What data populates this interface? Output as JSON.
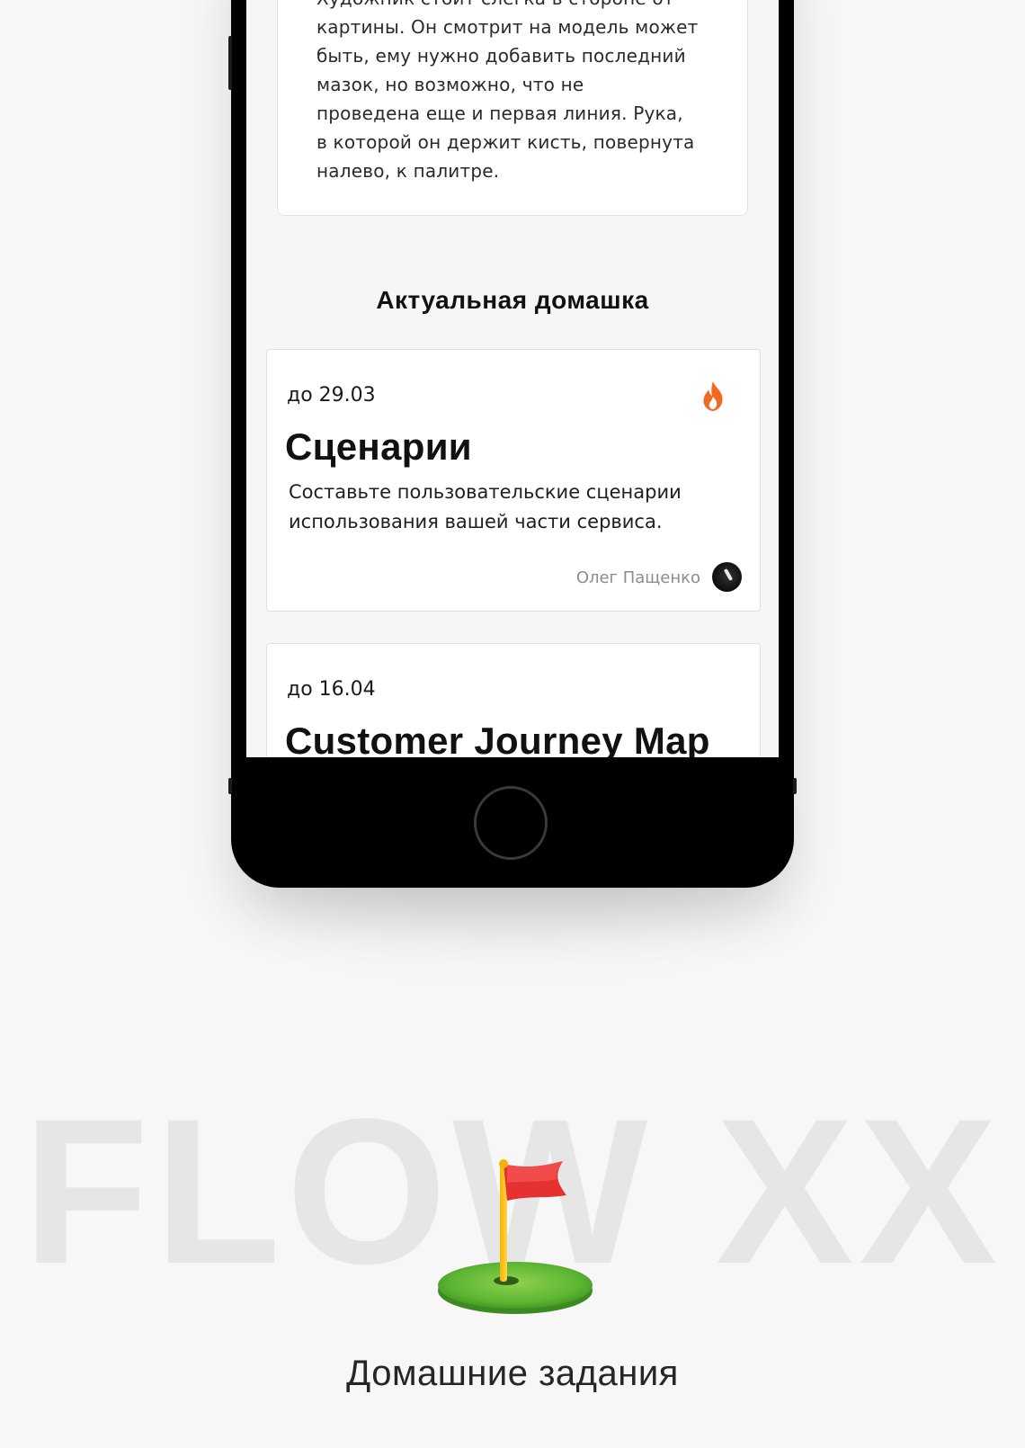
{
  "text_card": {
    "lines": [
      "Художник стоит слегка в стороне от",
      "картины. Он смотрит на модель может",
      "быть, ему нужно добавить последний",
      "мазок, но возможно, что не",
      "проведена еще и первая линия. Рука,",
      "в которой он держит кисть, повернута",
      "налево, к палитре."
    ]
  },
  "section": {
    "title": "Актуальная домашка"
  },
  "homework": [
    {
      "deadline": "до 29.03",
      "title": "Сценарии",
      "description_lines": [
        "Составьте пользовательские сценарии",
        "использования вашей части сервиса."
      ],
      "author": "Олег Пащенко",
      "icon": "flame-icon"
    },
    {
      "deadline": "до 16.04",
      "title": "Customer Journey Map"
    }
  ],
  "branding": {
    "watermark": "FLOW XX",
    "emoji": "flag-in-hole-icon",
    "caption": "Домашние задания"
  },
  "colors": {
    "flame": "#f26a21",
    "flag": "#e63131",
    "grass": "#5cb531"
  }
}
